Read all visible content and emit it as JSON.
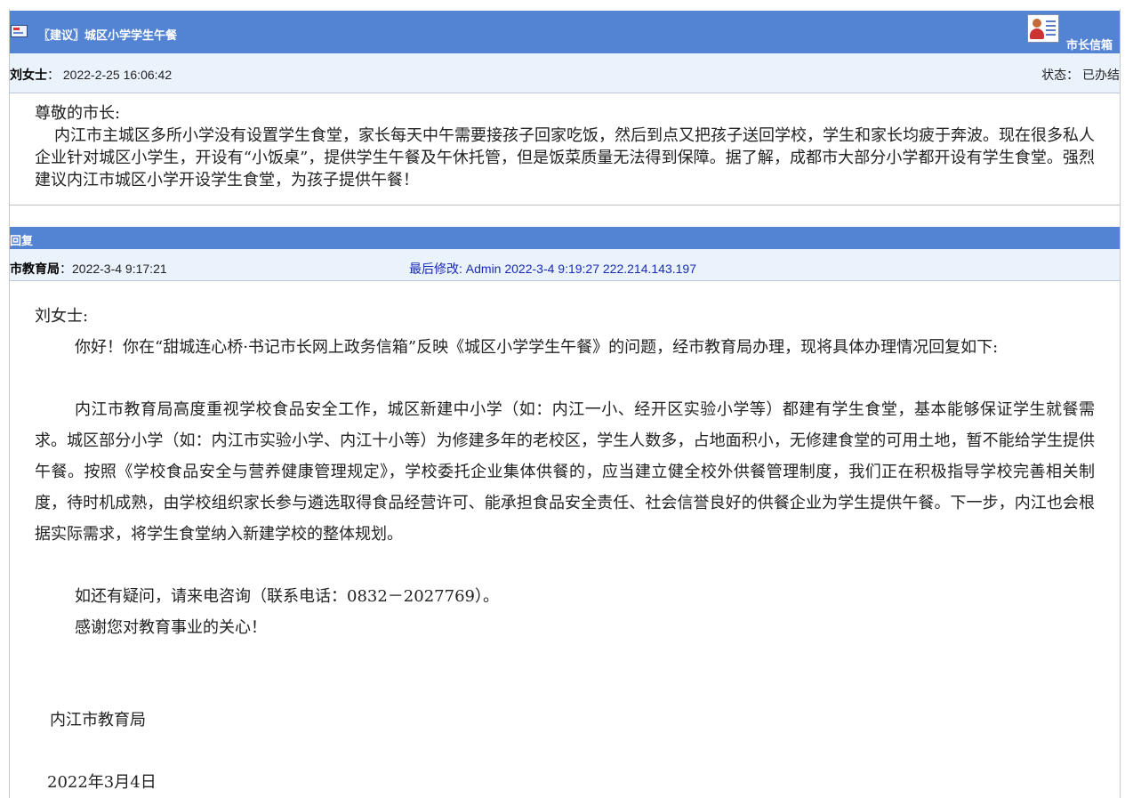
{
  "letter": {
    "title": "〖建议〗城区小学学生午餐",
    "mailbox_label": "市长信箱",
    "sender_name": "刘女士",
    "sender_time": "2022-2-25 16:06:42",
    "status_label": "状态：",
    "status_value": "已办结",
    "salutation": "尊敬的市长:",
    "body": "内江市主城区多所小学没有设置学生食堂，家长每天中午需要接孩子回家吃饭，然后到点又把孩子送回学校，学生和家长均疲于奔波。现在很多私人企业针对城区小学生，开设有“小饭桌”，提供学生午餐及午休托管，但是饭菜质量无法得到保障。据了解，成都市大部分小学都开设有学生食堂。强烈建议内江市城区小学开设学生食堂，为孩子提供午餐！"
  },
  "reply": {
    "section_label": "回复",
    "responder": "市教育局",
    "reply_time": "2022-3-4 9:17:21",
    "last_modified": "最后修改: Admin  2022-3-4 9:19:27  222.214.143.197",
    "salutation": "刘女士:",
    "para1": "你好！你在“甜城连心桥·书记市长网上政务信箱”反映《城区小学学生午餐》的问题，经市教育局办理，现将具体办理情况回复如下:",
    "para2": "内江市教育局高度重视学校食品安全工作，城区新建中小学（如：内江一小、经开区实验小学等）都建有学生食堂，基本能够保证学生就餐需求。城区部分小学（如：内江市实验小学、内江十小等）为修建多年的老校区，学生人数多，占地面积小，无修建食堂的可用土地，暂不能给学生提供午餐。按照《学校食品安全与营养健康管理规定》，学校委托企业集体供餐的，应当建立健全校外供餐管理制度，我们正在积极指导学校完善相关制度，待时机成熟，由学校组织家长参与遴选取得食品经营许可、能承担食品安全责任、社会信誉良好的供餐企业为学生提供午餐。下一步，内江也会根据实际需求，将学生食堂纳入新建学校的整体规划。",
    "para3": "如还有疑问，请来电咨询（联系电话：0832－2027769）。",
    "para4": "感谢您对教育事业的关心！",
    "signature": "内江市教育局",
    "date": "2022年3月4日"
  }
}
